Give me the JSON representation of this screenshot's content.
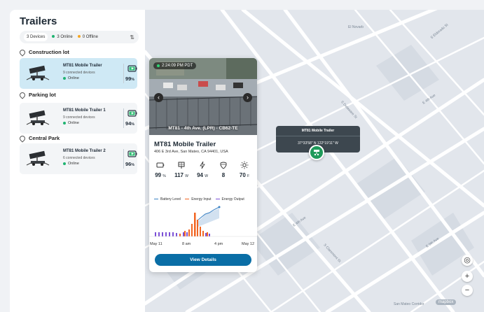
{
  "sidebar": {
    "title": "Trailers",
    "filters": {
      "all": "3 Devices",
      "online": "3 Online",
      "offline": "0 Offline"
    },
    "groups": [
      {
        "label": "Construction lot",
        "trailer": {
          "name": "MT81 Mobile Trailer",
          "devices": "9 connected devices",
          "status": "Online",
          "battery": "99",
          "unit": "%"
        }
      },
      {
        "label": "Parking lot",
        "trailer": {
          "name": "MT81 Mobile Trailer 1",
          "devices": "9 connected devices",
          "status": "Online",
          "battery": "94",
          "unit": "%"
        }
      },
      {
        "label": "Central Park",
        "trailer": {
          "name": "MT81 Mobile Trailer 2",
          "devices": "6 connected devices",
          "status": "Online",
          "battery": "96",
          "unit": "%"
        }
      }
    ]
  },
  "detail": {
    "camera_time": "2:24:09 PM PDT",
    "camera_caption": "MT81 - 4th Ave. (LPR) - CB62-TE",
    "title": "MT81 Mobile Trailer",
    "address": "406 E 3rd Ave, San Mateo, CA 94401, USA",
    "metrics": [
      {
        "icon": "battery-icon",
        "value": "99",
        "unit": "%"
      },
      {
        "icon": "solar-panel-icon",
        "value": "117",
        "unit": "W"
      },
      {
        "icon": "bolt-icon",
        "value": "94",
        "unit": "W"
      },
      {
        "icon": "shield-icon",
        "value": "8",
        "unit": ""
      },
      {
        "icon": "sun-icon",
        "value": "70",
        "unit": "F"
      }
    ],
    "legend": [
      {
        "label": "Battery Level",
        "color": "#3b82c4"
      },
      {
        "label": "Energy Input",
        "color": "#f26522"
      },
      {
        "label": "Energy Output",
        "color": "#7b4fd6"
      }
    ],
    "x_ticks": [
      "May 11",
      "8 am",
      "4 pm",
      "May 12"
    ],
    "view_button": "View Details"
  },
  "map": {
    "popup_title": "MT81 Mobile Trailer",
    "popup_coords": "37°33'58\" N 122°19'11\" W",
    "streets": [
      "El Novarb",
      "S Eldorado St",
      "S Delaware St",
      "E 4th Ave",
      "E 4th Ave",
      "S Claremont St",
      "E 5th Ave",
      "San Mateo Corridor"
    ],
    "attribution": "mapbox"
  },
  "colors": {
    "accent": "#0a6ea6",
    "online": "#1fb371",
    "offline": "#f5a623",
    "marker": "#1f9a5a"
  }
}
